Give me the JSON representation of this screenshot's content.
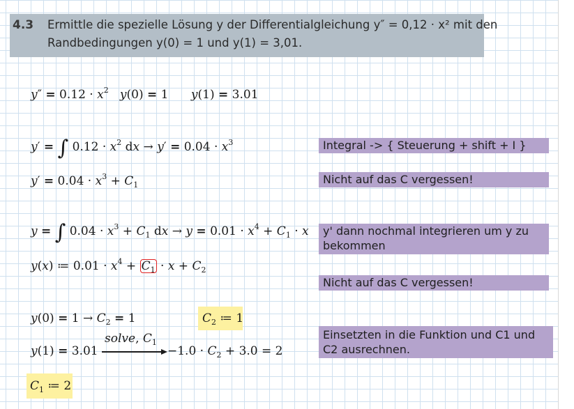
{
  "task": {
    "number": "4.3",
    "line1": "Ermittle die spezielle Lösung y der Differentialgleichung y″ = 0,12 · x² mit den",
    "line2": "Randbedingungen y(0) = 1 und y(1) = 3,01."
  },
  "notes": {
    "integral_hint": "Integral -> { Steuerung + shift + I }",
    "constant_hint_1": "Nicht auf das C vergessen!",
    "integrate_again_line1": "y' dann nochmal integrieren um y zu",
    "integrate_again_line2": "bekommen",
    "constant_hint_2": "Nicht auf das C vergessen!",
    "insert_line1": "Einsetzten in die Funktion und C1 und",
    "insert_line2": "C2 ausrechnen."
  },
  "solve_keyword": "solve",
  "colors": {
    "grid": "#cfe0ef",
    "header_bg": "#b3bec7",
    "note_bg": "#b4a3cc",
    "highlight_bg": "#fdf1a0",
    "placeholder_box": "#e02020"
  }
}
